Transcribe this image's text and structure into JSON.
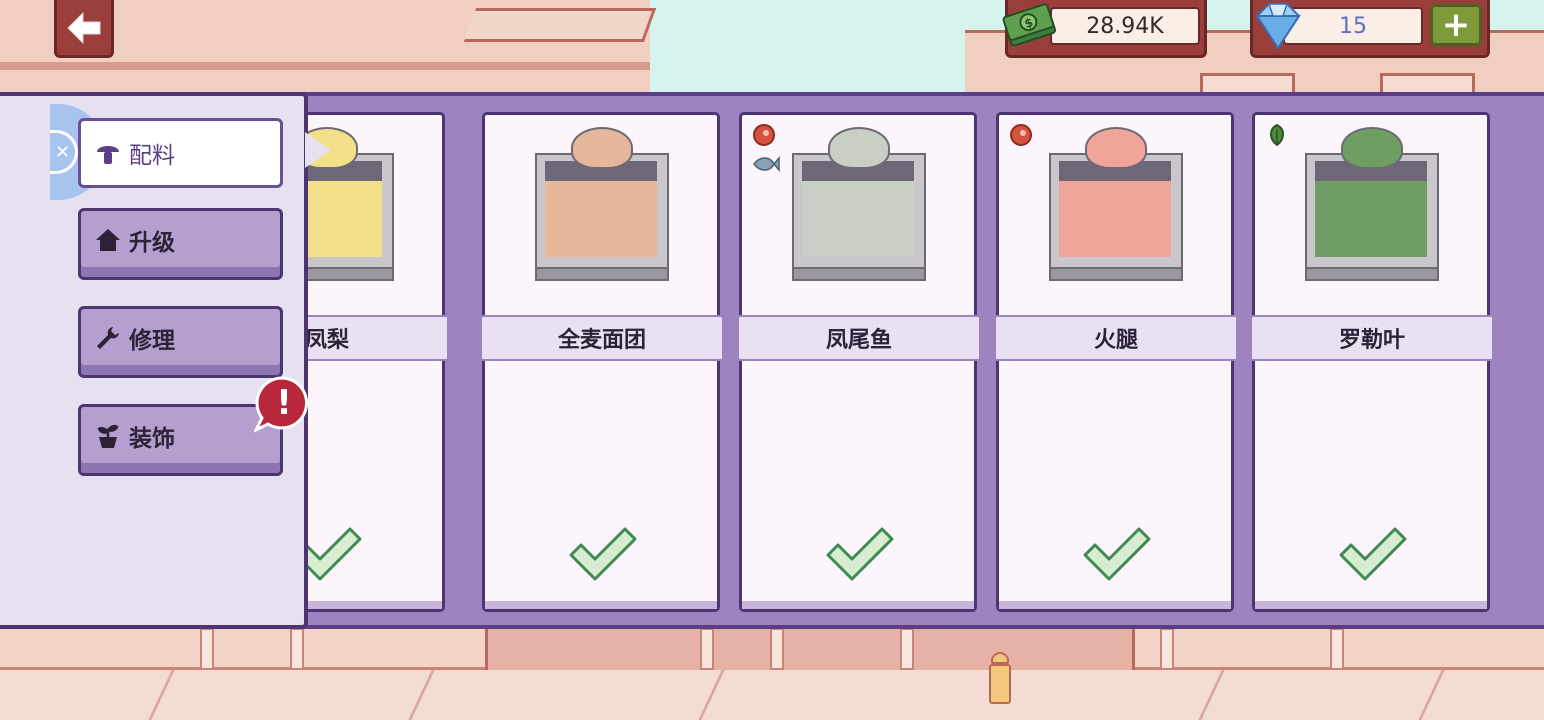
{
  "topbar": {
    "back_icon": "arrow-left-icon",
    "cash": {
      "icon": "money-stack-icon",
      "value": "28.94K"
    },
    "gems": {
      "icon": "diamond-icon",
      "value": "15",
      "add_label": "+"
    }
  },
  "menu": {
    "items": [
      {
        "label": "配料",
        "icon": "mushroom-icon",
        "active": true
      },
      {
        "label": "升级",
        "icon": "house-icon",
        "active": false
      },
      {
        "label": "修理",
        "icon": "wrench-icon",
        "active": false
      },
      {
        "label": "装饰",
        "icon": "sprout-pot-icon",
        "active": false,
        "alert": "!"
      }
    ]
  },
  "ingredients": [
    {
      "name": "凤梨",
      "fill": "#f3e18a",
      "status": "owned"
    },
    {
      "name": "全麦面团",
      "fill": "#e7b79b",
      "status": "owned"
    },
    {
      "name": "凤尾鱼",
      "fill": "#c9cfc4",
      "status": "owned",
      "badges": [
        "meat-icon",
        "fish-icon"
      ]
    },
    {
      "name": "火腿",
      "fill": "#f0a49a",
      "status": "owned",
      "badges": [
        "meat-icon"
      ]
    },
    {
      "name": "罗勒叶",
      "fill": "#6f9e63",
      "status": "owned",
      "badges": [
        "leaf-icon"
      ]
    }
  ],
  "colors": {
    "panel": "#9d84c0",
    "panel_border": "#5b3f86",
    "check": "#d7ecd0",
    "check_border": "#3f8a52",
    "topbar_bg": "#9a3e3b"
  }
}
